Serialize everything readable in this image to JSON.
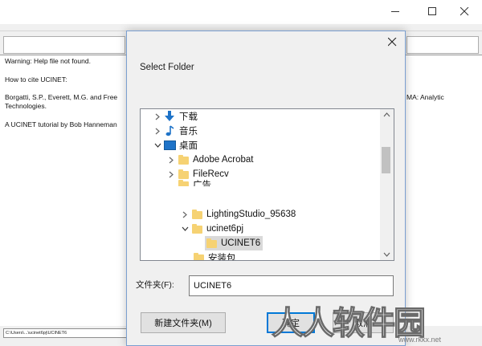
{
  "main": {
    "content_lines": [
      "Warning: Help file not found.",
      "How to cite UCINET:",
      "Borgatti, S.P., Everett, M.G. and Free",
      "MA: Analytic",
      "Technologies.",
      "A UCINET tutorial by Bob Hanneman"
    ],
    "status_path": "C:\\Users\\...\\ucinet6pj\\UCINET6"
  },
  "dialog": {
    "title": "Select Folder",
    "tree": [
      {
        "label": "下载",
        "icon": "download-arrow-icon",
        "expand": "collapsed",
        "level": 1
      },
      {
        "label": "音乐",
        "icon": "music-note-icon",
        "expand": "collapsed",
        "level": 1
      },
      {
        "label": "桌面",
        "icon": "desktop-icon",
        "expand": "expanded",
        "level": 1
      },
      {
        "label": "Adobe Acrobat",
        "icon": "folder-icon",
        "expand": "collapsed",
        "level": 2
      },
      {
        "label": "FileRecv",
        "icon": "folder-icon",
        "expand": "collapsed",
        "level": 2
      },
      {
        "label": "广告",
        "icon": "folder-icon",
        "expand": "none",
        "level": 2
      },
      {
        "label": "LightingStudio_95638",
        "icon": "folder-icon",
        "expand": "collapsed",
        "level": 3
      },
      {
        "label": "ucinet6pj",
        "icon": "folder-icon",
        "expand": "expanded",
        "level": 3
      },
      {
        "label": "UCINET6",
        "icon": "folder-icon",
        "expand": "none",
        "level": 4,
        "selected": true
      },
      {
        "label": "安装包",
        "icon": "folder-icon",
        "expand": "none",
        "level": 3
      }
    ],
    "folder_label": "文件夹(F):",
    "folder_value": "UCINET6",
    "new_folder_button": "新建文件夹(M)",
    "ok_button": "确定",
    "cancel_button": "取消"
  },
  "watermark": {
    "text": "人人软件园",
    "url": "www.rkkx.net"
  },
  "colors": {
    "accent": "#0078d7",
    "folder": "#f6d273",
    "selection": "#d9d9d9"
  }
}
